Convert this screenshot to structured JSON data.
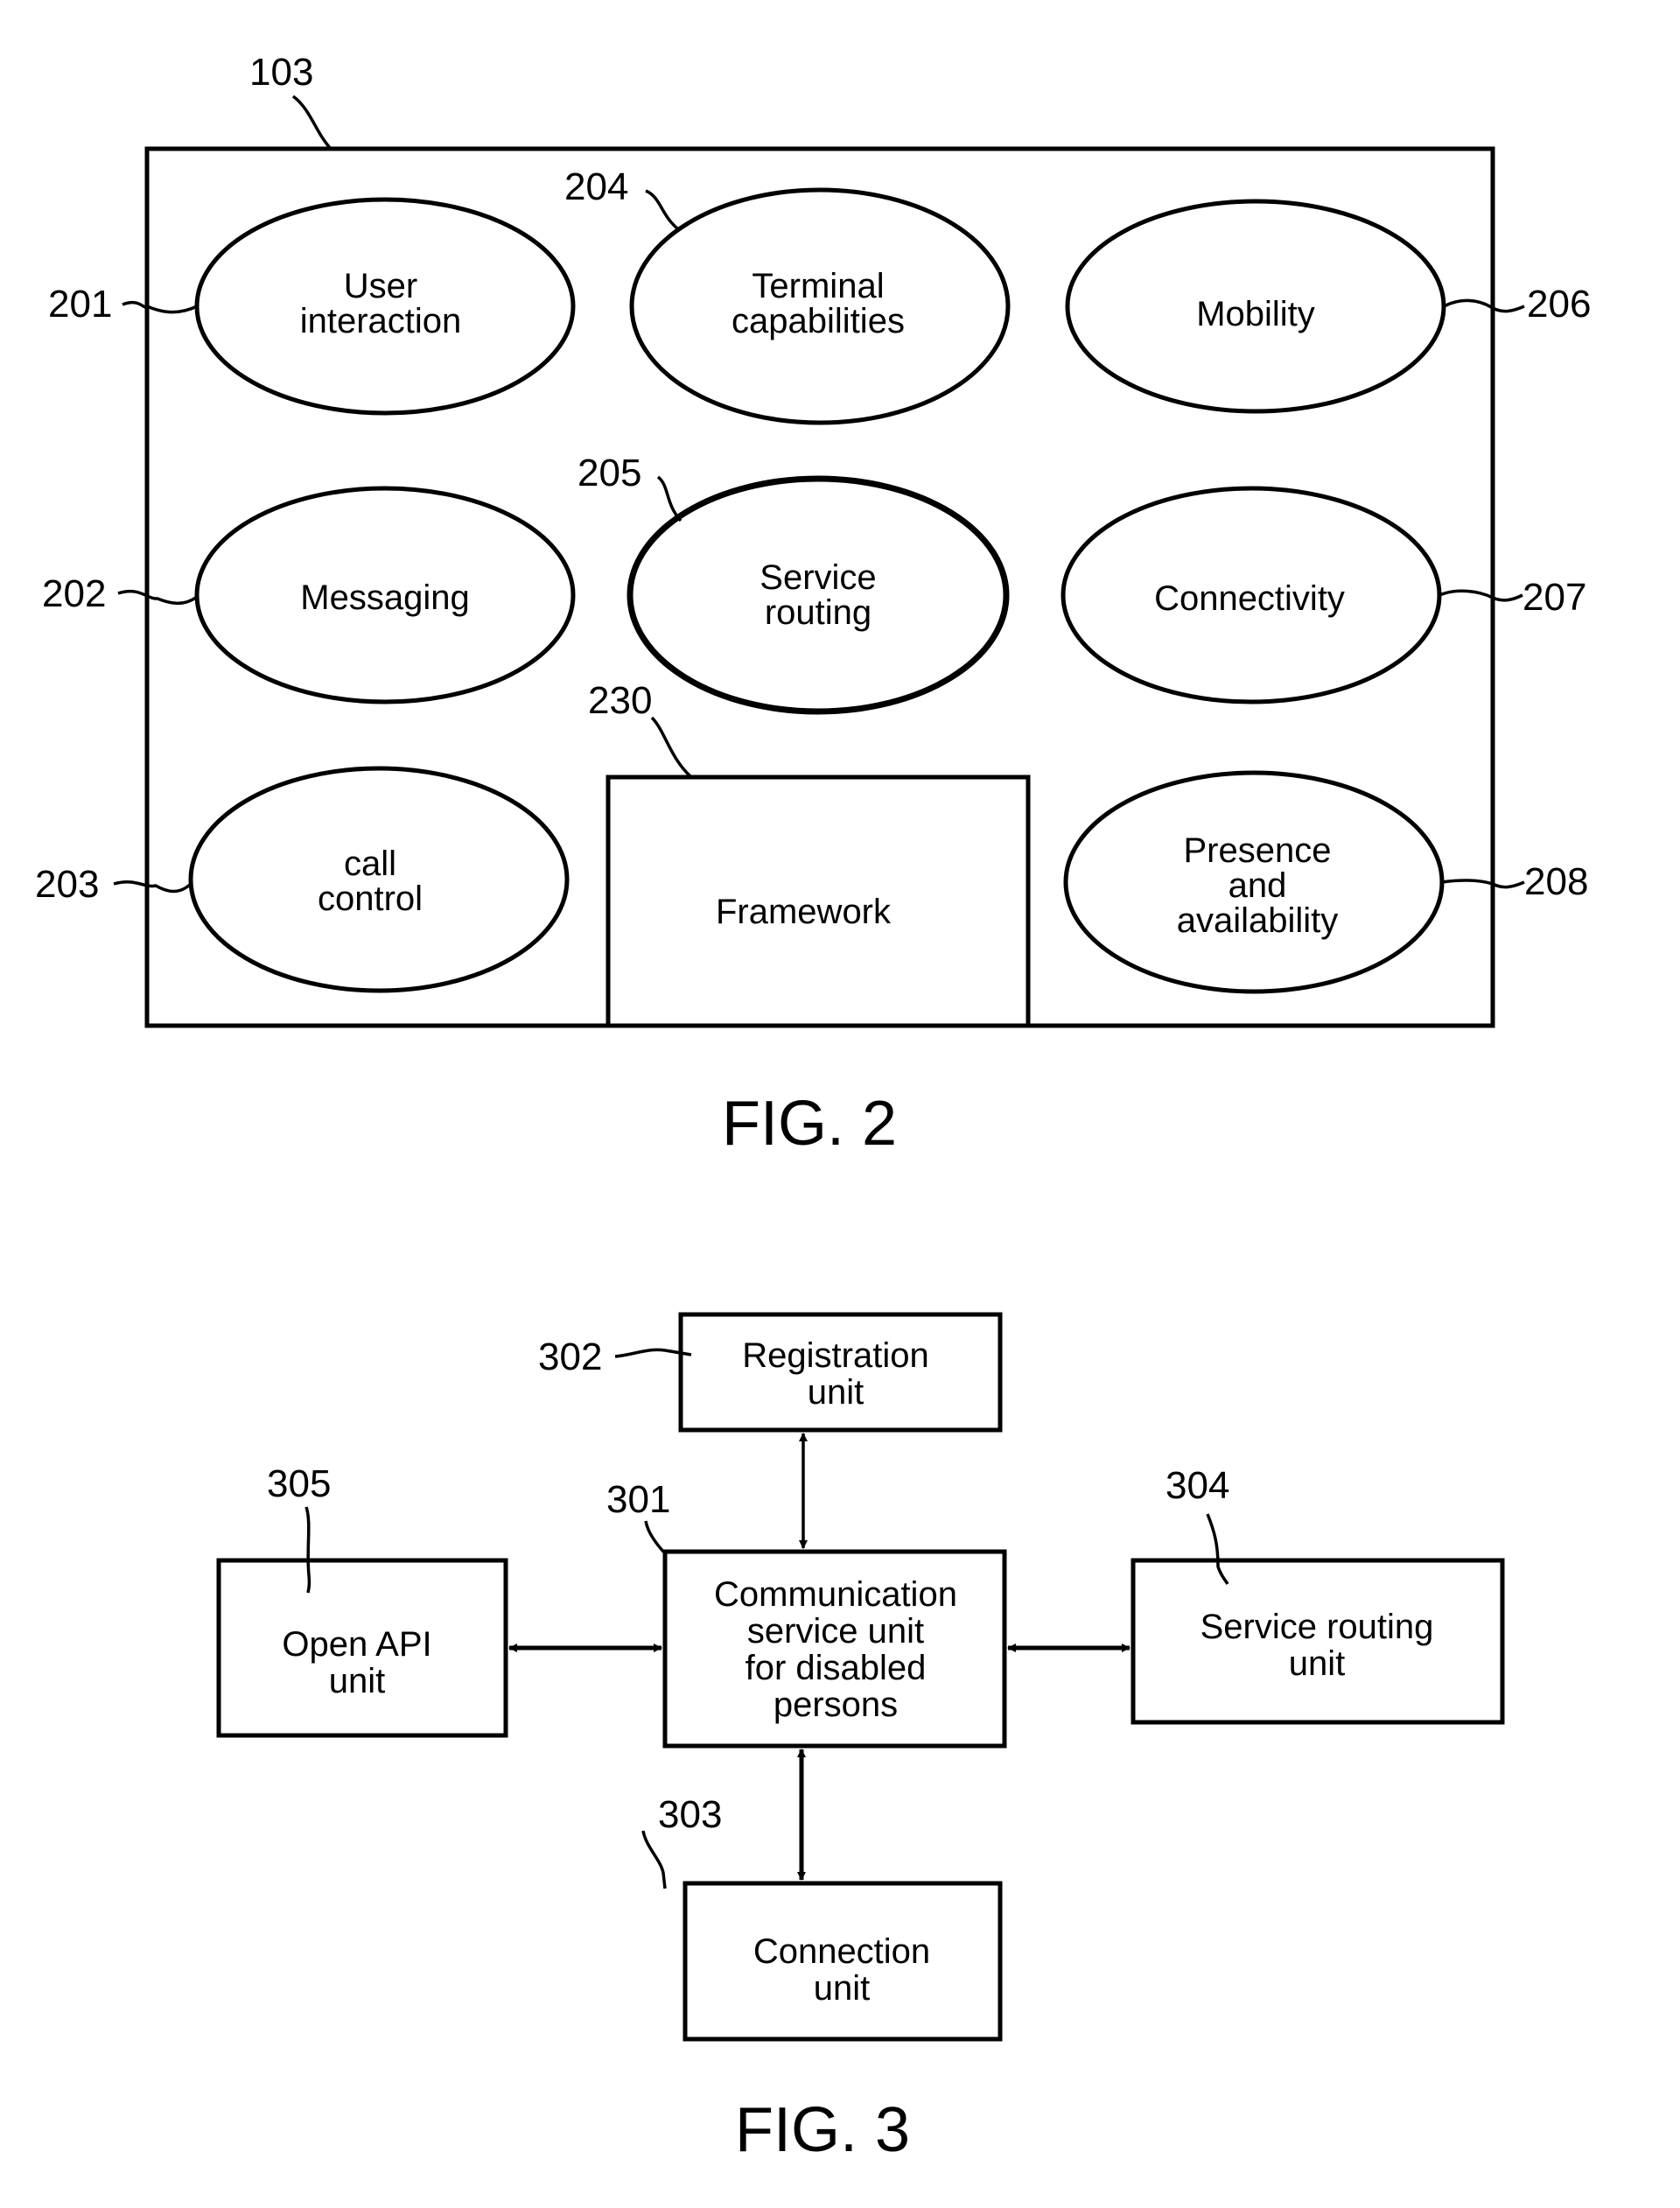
{
  "fig2": {
    "caption": "FIG. 2",
    "container_ref": "103",
    "nodes": [
      {
        "ref": "201",
        "lines": [
          "User",
          "interaction"
        ]
      },
      {
        "ref": "202",
        "lines": [
          "Messaging"
        ]
      },
      {
        "ref": "203",
        "lines": [
          "call",
          "control"
        ]
      },
      {
        "ref": "204",
        "lines": [
          "Terminal",
          "capabilities"
        ]
      },
      {
        "ref": "205",
        "lines": [
          "Service",
          "routing"
        ]
      },
      {
        "ref": "206",
        "lines": [
          "Mobility"
        ]
      },
      {
        "ref": "207",
        "lines": [
          "Connectivity"
        ]
      },
      {
        "ref": "208",
        "lines": [
          "Presence",
          "and",
          "availability"
        ]
      }
    ],
    "framework": {
      "ref": "230",
      "label": "Framework"
    }
  },
  "fig3": {
    "caption": "FIG. 3",
    "nodes": [
      {
        "ref": "301",
        "lines": [
          "Communication",
          "service unit",
          "for disabled",
          "persons"
        ]
      },
      {
        "ref": "302",
        "lines": [
          "Registration",
          "unit"
        ]
      },
      {
        "ref": "303",
        "lines": [
          "Connection",
          "unit"
        ]
      },
      {
        "ref": "304",
        "lines": [
          "Service routing",
          "unit"
        ]
      },
      {
        "ref": "305",
        "lines": [
          "Open API",
          "unit"
        ]
      }
    ],
    "connections": [
      {
        "from": "301",
        "to": "302",
        "type": "bidirectional"
      },
      {
        "from": "301",
        "to": "303",
        "type": "bidirectional"
      },
      {
        "from": "301",
        "to": "304",
        "type": "bidirectional"
      },
      {
        "from": "301",
        "to": "305",
        "type": "bidirectional"
      }
    ]
  }
}
